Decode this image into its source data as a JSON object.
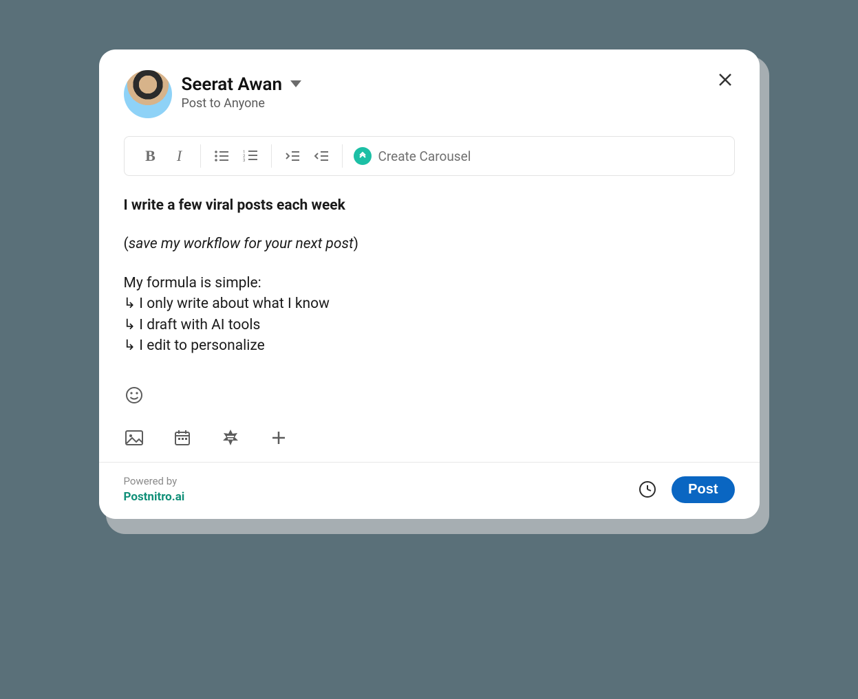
{
  "header": {
    "user_name": "Seerat Awan",
    "visibility": "Post to Anyone"
  },
  "toolbar": {
    "bold_label": "B",
    "italic_label": "I",
    "carousel_label": "Create Carousel"
  },
  "content": {
    "bold_line": "I write a few viral posts each week",
    "paren_open": "(",
    "paren_italic": "save my workflow for your next post",
    "paren_close": ")",
    "intro": "My formula is simple:",
    "bullets": [
      "↳ I only write about what I know",
      "↳ I draft with AI tools",
      "↳ I edit to personalize"
    ]
  },
  "footer": {
    "powered_by_label": "Powered by",
    "brand": "Postnitro.ai",
    "post_label": "Post"
  }
}
